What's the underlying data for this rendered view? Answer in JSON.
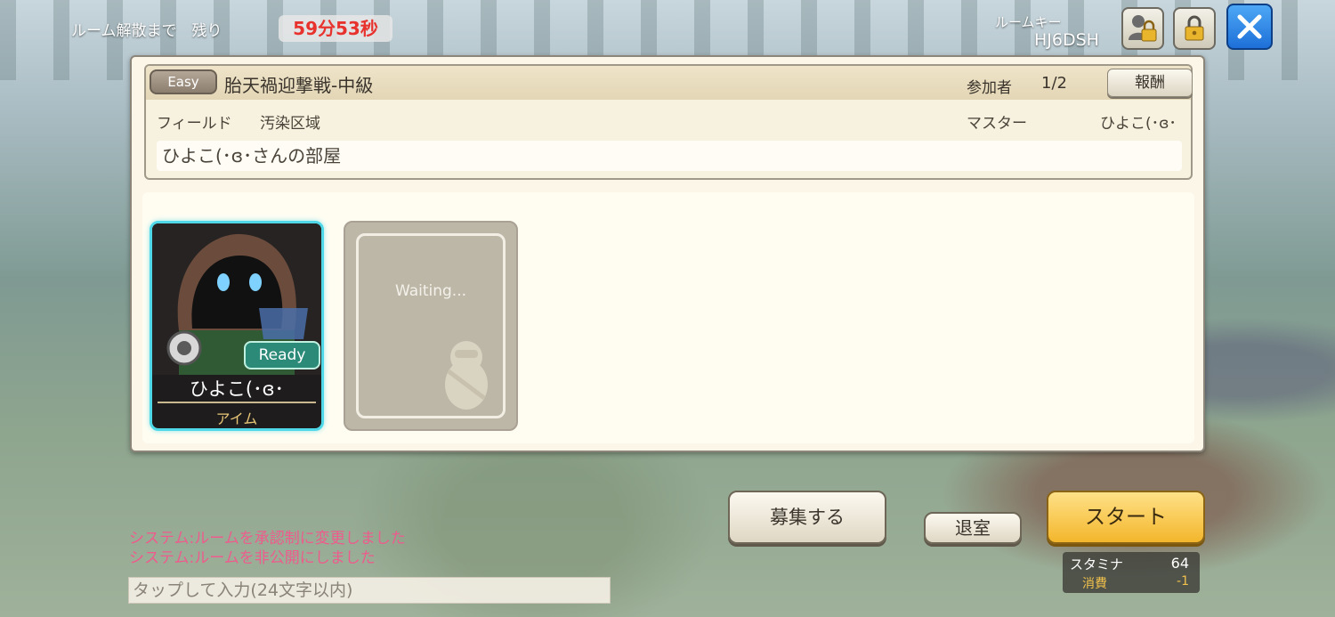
{
  "header": {
    "countdown_label": "ルーム解散まで　残り",
    "countdown_value": "59分53秒",
    "room_key_label": "ルームキー",
    "room_key_value": "HJ6DSH"
  },
  "icons": {
    "member_lock": "person-lock-icon",
    "lock": "lock-icon",
    "close": "close-icon"
  },
  "room": {
    "difficulty": "Easy",
    "quest_title": "胎天禍迎撃戦-中級",
    "participants_label": "参加者",
    "participants_value": "1/2",
    "reward_label": "報酬",
    "field_label": "フィールド",
    "field_value": "汚染区域",
    "master_label": "マスター",
    "master_value": "ひよこ(･ɞ･",
    "room_name": "ひよこ(･ɞ･さんの部屋"
  },
  "members": {
    "player": {
      "status": "Ready",
      "name": "ひよこ(･ɞ･",
      "class": "アイム"
    },
    "empty_slot": {
      "status": "Waiting..."
    }
  },
  "actions": {
    "recruit_label": "募集する",
    "leave_label": "退室",
    "start_label": "スタート",
    "stamina_label": "スタミナ",
    "stamina_value": "64",
    "cost_label": "消費",
    "cost_value": "-1"
  },
  "chat": {
    "log": [
      "システム:ルームを承認制に変更しました",
      "システム:ルームを非公開にしました"
    ],
    "input_placeholder": "タップして入力(24文字以内)"
  },
  "colors": {
    "countdown": "#e8322d",
    "ready": "#2c8a78",
    "start": "#f3b62c",
    "log_text": "#ee5b8c",
    "close_button": "#1e6fd8"
  }
}
